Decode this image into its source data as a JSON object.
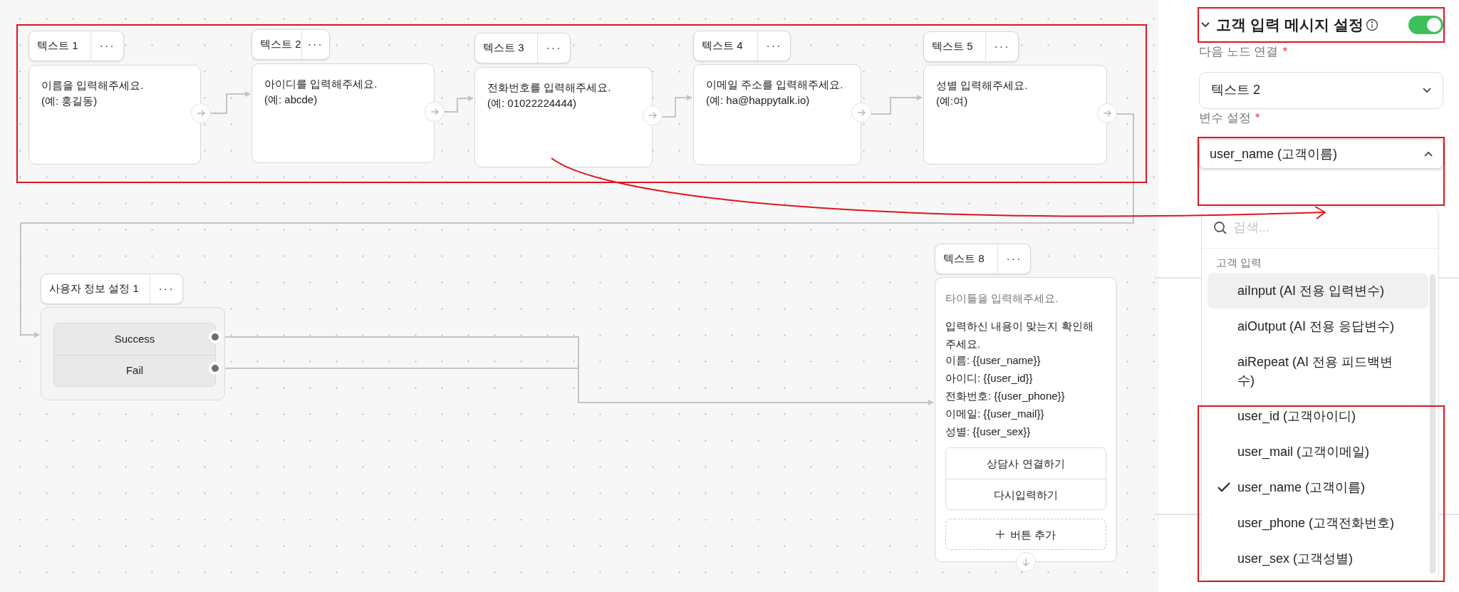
{
  "canvas": {
    "nodes": [
      {
        "kind": "text",
        "title": "텍스트 1",
        "menu": "···",
        "lines": [
          "이름을 입력해주세요.",
          "(예: 홍길동)"
        ]
      },
      {
        "kind": "text",
        "title": "텍스트 2",
        "menu": "···",
        "lines": [
          "아이디를 입력해주세요.",
          "(예: abcde)"
        ]
      },
      {
        "kind": "text",
        "title": "텍스트 3",
        "menu": "···",
        "lines": [
          "전화번호를 입력해주세요.",
          "(예: 01022224444)"
        ]
      },
      {
        "kind": "text",
        "title": "텍스트 4",
        "menu": "···",
        "lines": [
          "이메일 주소를 입력해주세요.",
          "(예: ha@happytalk.io)"
        ]
      },
      {
        "kind": "text",
        "title": "텍스트 5",
        "menu": "···",
        "lines": [
          "성별 입력해주세요.",
          "(예:여)"
        ]
      },
      {
        "kind": "user_info",
        "title": "사용자 정보 설정 1",
        "menu": "···",
        "outputs": [
          "Success",
          "Fail"
        ]
      },
      {
        "kind": "text_buttons",
        "title": "텍스트 8",
        "menu": "···",
        "title_placeholder": "타이틀을 입력해주세요.",
        "lines": [
          "입력하신 내용이 맞는지 확인해주세요.",
          "이름: {{user_name}}",
          "아이디: {{user_id}}",
          "전화번호: {{user_phone}}",
          "이메일: {{user_mail}}",
          "성별: {{user_sex}}"
        ],
        "buttons": [
          "상담사 연결하기",
          "다시입력하기"
        ],
        "add_button": "버튼 추가"
      }
    ]
  },
  "panel": {
    "section": {
      "title": "고객 입력 메시지 설정",
      "expanded": true,
      "on": true
    },
    "next_node": {
      "label": "다음 노드 연결",
      "required_mark": "*",
      "value": "텍스트 2"
    },
    "variable": {
      "label": "변수 설정",
      "required_mark": "*",
      "value": "user_name (고객이름)",
      "expanded": true
    },
    "dropdown": {
      "search_placeholder": "검색...",
      "group": "고객 입력",
      "options": [
        {
          "label": "aiInput (AI 전용 입력변수)",
          "selected": false,
          "hovered": true
        },
        {
          "label": "aiOutput (AI 전용 응답변수)",
          "selected": false,
          "hovered": false
        },
        {
          "label": "aiRepeat (AI 전용 피드백변수)",
          "selected": false,
          "hovered": false
        },
        {
          "label": "user_id (고객아이디)",
          "selected": false,
          "hovered": false
        },
        {
          "label": "user_mail (고객이메일)",
          "selected": false,
          "hovered": false
        },
        {
          "label": "user_name (고객이름)",
          "selected": true,
          "hovered": false
        },
        {
          "label": "user_phone (고객전화번호)",
          "selected": false,
          "hovered": false
        },
        {
          "label": "user_sex (고객성별)",
          "selected": false,
          "hovered": false
        }
      ]
    }
  }
}
